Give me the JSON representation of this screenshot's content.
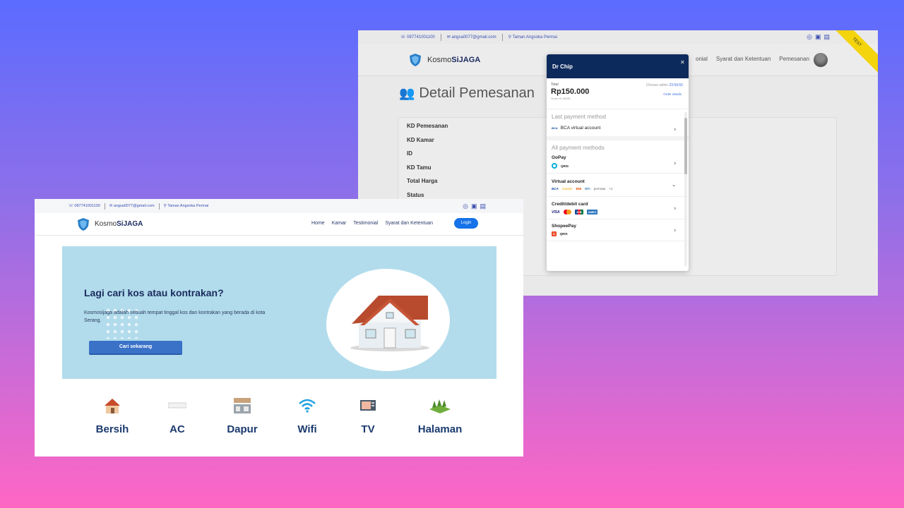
{
  "back": {
    "topbar": {
      "phone": "087741001100",
      "email": "angsa0077@gmail.com",
      "address": "Taman Angsoka Permai"
    },
    "brand": {
      "prefix": "Kosmo",
      "suffix": "SiJAGA"
    },
    "nav": {
      "item1": "onial",
      "item2": "Syarat dan Ketentuan",
      "item3": "Pemesanan"
    },
    "ribbon": "TEST",
    "title": "Detail Pemesanan",
    "rows": [
      "KD Pemesanan",
      "KD Kamar",
      "ID",
      "KD Tamu",
      "Total Harga",
      "Status"
    ]
  },
  "modal": {
    "merchant": "Dr Chip",
    "close": "×",
    "total_label": "Total",
    "amount": "Rp150.000",
    "order_id": "Order ID #6335",
    "choose_label": "Choose within",
    "countdown": "23:59:55",
    "order_details": "Order details",
    "last_method_label": "Last payment method",
    "last_method": "BCA virtual account",
    "all_methods_label": "All payment methods",
    "methods": [
      {
        "name": "GoPay",
        "logos": [
          "gopay",
          "QRIS"
        ]
      },
      {
        "name": "Virtual account",
        "logos": [
          "BCA",
          "mandiri",
          "BNI",
          "BRI",
          "permata",
          "+1"
        ]
      },
      {
        "name": "Credit/debit card",
        "logos": [
          "VISA",
          "mastercard",
          "JCB",
          "AMEX"
        ]
      },
      {
        "name": "ShopeePay",
        "logos": [
          "S",
          "QRIS"
        ]
      }
    ]
  },
  "front": {
    "topbar": {
      "phone": "087741001100",
      "email": "angsa0077@gmail.com",
      "address": "Taman Angsoka Permai"
    },
    "brand": {
      "prefix": "Kosmo",
      "suffix": "SiJAGA"
    },
    "nav": {
      "home": "Home",
      "kamar": "Kamar",
      "testimonial": "Testimonial",
      "syarat": "Syarat dan Ketentuan",
      "login": "Login"
    },
    "hero": {
      "title": "Lagi cari kos atau kontrakan?",
      "desc": "Kosmosijaga adalah sebuah tempat tinggal kos dan kontrakan yang berada di kota Serang.",
      "cta": "Cari sekarang"
    },
    "features": [
      "Bersih",
      "AC",
      "Dapur",
      "Wifi",
      "TV",
      "Halaman"
    ]
  },
  "colors": {
    "navy": "#0d2a5c",
    "accent": "#1572e8",
    "hero_bg": "#b2dcec",
    "ribbon": "#f4d40c"
  }
}
